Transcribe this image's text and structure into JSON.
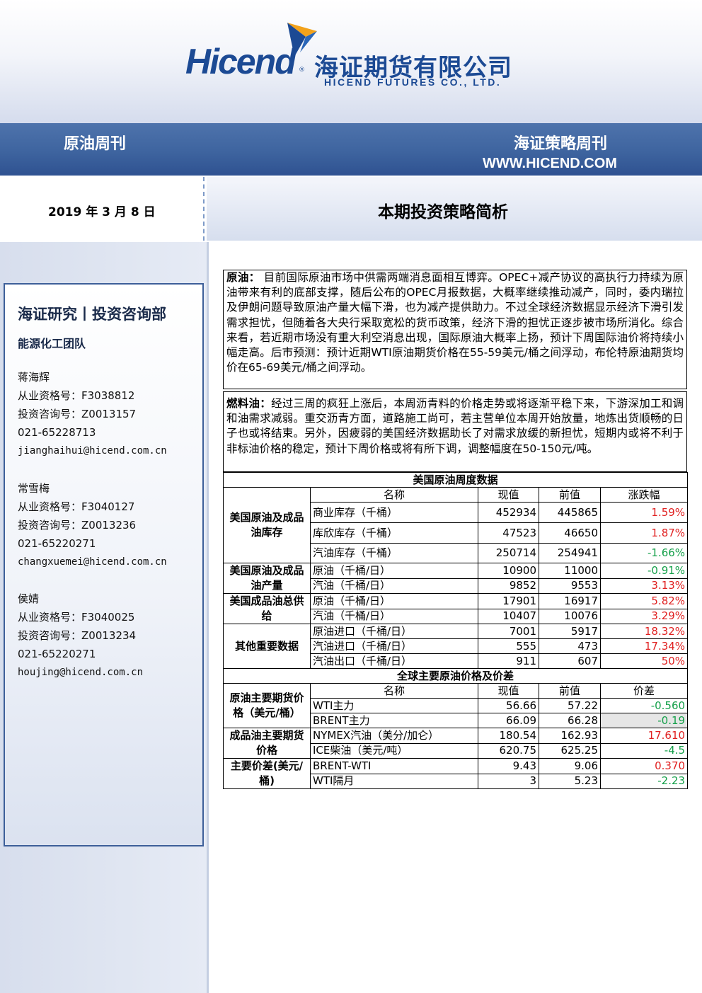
{
  "header": {
    "logo_brand": "Hicend",
    "logo_reg": "®",
    "logo_cn": "海证期货有限公司",
    "logo_en": "HICEND  FUTURES  CO.,  LTD.",
    "band_left": "原油周刊",
    "band_right": "海证策略周刊",
    "url": "WWW.HICEND.COM"
  },
  "date": "2019 年 3 月 8 日",
  "title": "本期投资策略简析",
  "sidebar": {
    "dept": "海证研究丨投资咨询部",
    "team": "能源化工团队",
    "analysts": [
      {
        "name": "蒋海辉",
        "qual": "从业资格号：F3038812",
        "consult": "投资咨询号：Z0013157",
        "phone": "021-65228713",
        "email": "jianghaihui@hicend.com.cn"
      },
      {
        "name": "常雪梅",
        "qual": "从业资格号：F3040127",
        "consult": "投资咨询号：Z0013236",
        "phone": "021-65220271",
        "email": "changxuemei@hicend.com.cn"
      },
      {
        "name": "侯婧",
        "qual": "从业资格号：F3040025",
        "consult": "投资咨询号：Z0013234",
        "phone": "021-65220271",
        "email": "houjing@hicend.com.cn"
      }
    ]
  },
  "crude": {
    "lead": "原油：",
    "body": " 目前国际原油市场中供需两端消息面相互博弈。OPEC+减产协议的高执行力持续为原油带来有利的底部支撑，随后公布的OPEC月报数据，大概率继续推动减产，同时，委内瑞拉及伊朗问题导致原油产量大幅下滑，也为减产提供助力。不过全球经济数据显示经济下滑引发需求担忧，但随着各大央行采取宽松的货币政策，经济下滑的担忧正逐步被市场所消化。综合来看，若近期市场没有重大利空消息出现，国际原油大概率上扬，预计下周国际油价将持续小幅走高。后市预测：预计近期WTI原油期货价格在55-59美元/桶之间浮动，布伦特原油期货均价在65-69美元/桶之间浮动。"
  },
  "fuel": {
    "lead": "燃料油：",
    "body": "经过三周的疯狂上涨后，本周沥青料的价格走势或将逐渐平稳下来，下游深加工和调和油需求减弱。重交沥青方面，道路施工尚可，若主营单位本周开始放量，地炼出货顺畅的日子也或将结束。另外，因疲弱的美国经济数据助长了对需求放缓的新担忧，短期内或将不利于非标油价格的稳定，预计下周价格或将有所下调，调整幅度在50-150元/吨。"
  },
  "us_table": {
    "title": "美国原油周度数据",
    "headers": [
      "名称",
      "现值",
      "前值",
      "涨跌幅"
    ],
    "groups": [
      {
        "label": "美国原油及成品油库存",
        "rows": [
          {
            "name": "商业库存（千桶）",
            "cur": "452934",
            "prev": "445865",
            "chg": "1.59%",
            "dir": "up"
          },
          {
            "name": "库欣库存（千桶）",
            "cur": "47523",
            "prev": "46650",
            "chg": "1.87%",
            "dir": "up"
          },
          {
            "name": "汽油库存（千桶）",
            "cur": "250714",
            "prev": "254941",
            "chg": "-1.66%",
            "dir": "down"
          }
        ]
      },
      {
        "label": "美国原油及成品油产量",
        "rows": [
          {
            "name": "原油（千桶/日）",
            "cur": "10900",
            "prev": "11000",
            "chg": "-0.91%",
            "dir": "down"
          },
          {
            "name": "汽油（千桶/日）",
            "cur": "9852",
            "prev": "9553",
            "chg": "3.13%",
            "dir": "up"
          }
        ]
      },
      {
        "label": "美国成品油总供给",
        "rows": [
          {
            "name": "原油（千桶/日）",
            "cur": "17901",
            "prev": "16917",
            "chg": "5.82%",
            "dir": "up"
          },
          {
            "name": "汽油（千桶/日）",
            "cur": "10407",
            "prev": "10076",
            "chg": "3.29%",
            "dir": "up"
          }
        ]
      },
      {
        "label": "其他重要数据",
        "rows": [
          {
            "name": "原油进口（千桶/日）",
            "cur": "7001",
            "prev": "5917",
            "chg": "18.32%",
            "dir": "up"
          },
          {
            "name": "汽油进口（千桶/日）",
            "cur": "555",
            "prev": "473",
            "chg": "17.34%",
            "dir": "up"
          },
          {
            "name": "汽油出口（千桶/日）",
            "cur": "911",
            "prev": "607",
            "chg": "50%",
            "dir": "up"
          }
        ]
      }
    ]
  },
  "global_table": {
    "title": "全球主要原油价格及价差",
    "headers": [
      "名称",
      "现值",
      "前值",
      "价差"
    ],
    "groups": [
      {
        "label": "原油主要期货价格（美元/桶）",
        "rows": [
          {
            "name": "WTI主力",
            "cur": "56.66",
            "prev": "57.22",
            "chg": "-0.560",
            "dir": "down"
          },
          {
            "name": "BRENT主力",
            "cur": "66.09",
            "prev": "66.28",
            "chg": "-0.19",
            "dir": "down"
          }
        ]
      },
      {
        "label": "成品油主要期货价格",
        "rows": [
          {
            "name": "NYMEX汽油（美分/加仑）",
            "cur": "180.54",
            "prev": "162.93",
            "chg": "17.610",
            "dir": "up"
          },
          {
            "name": "ICE柴油（美元/吨）",
            "cur": "620.75",
            "prev": "625.25",
            "chg": "-4.5",
            "dir": "down"
          }
        ]
      },
      {
        "label": "主要价差(美元/桶)",
        "rows": [
          {
            "name": "BRENT-WTI",
            "cur": "9.43",
            "prev": "9.06",
            "chg": "0.370",
            "dir": "up"
          },
          {
            "name": "WTI隔月",
            "cur": "3",
            "prev": "5.23",
            "chg": "-2.23",
            "dir": "down"
          }
        ]
      }
    ]
  },
  "colors": {
    "brand_blue": "#1c4a94",
    "band_blue": "#3e649f",
    "up": "#e02020",
    "down": "#15a04a"
  }
}
